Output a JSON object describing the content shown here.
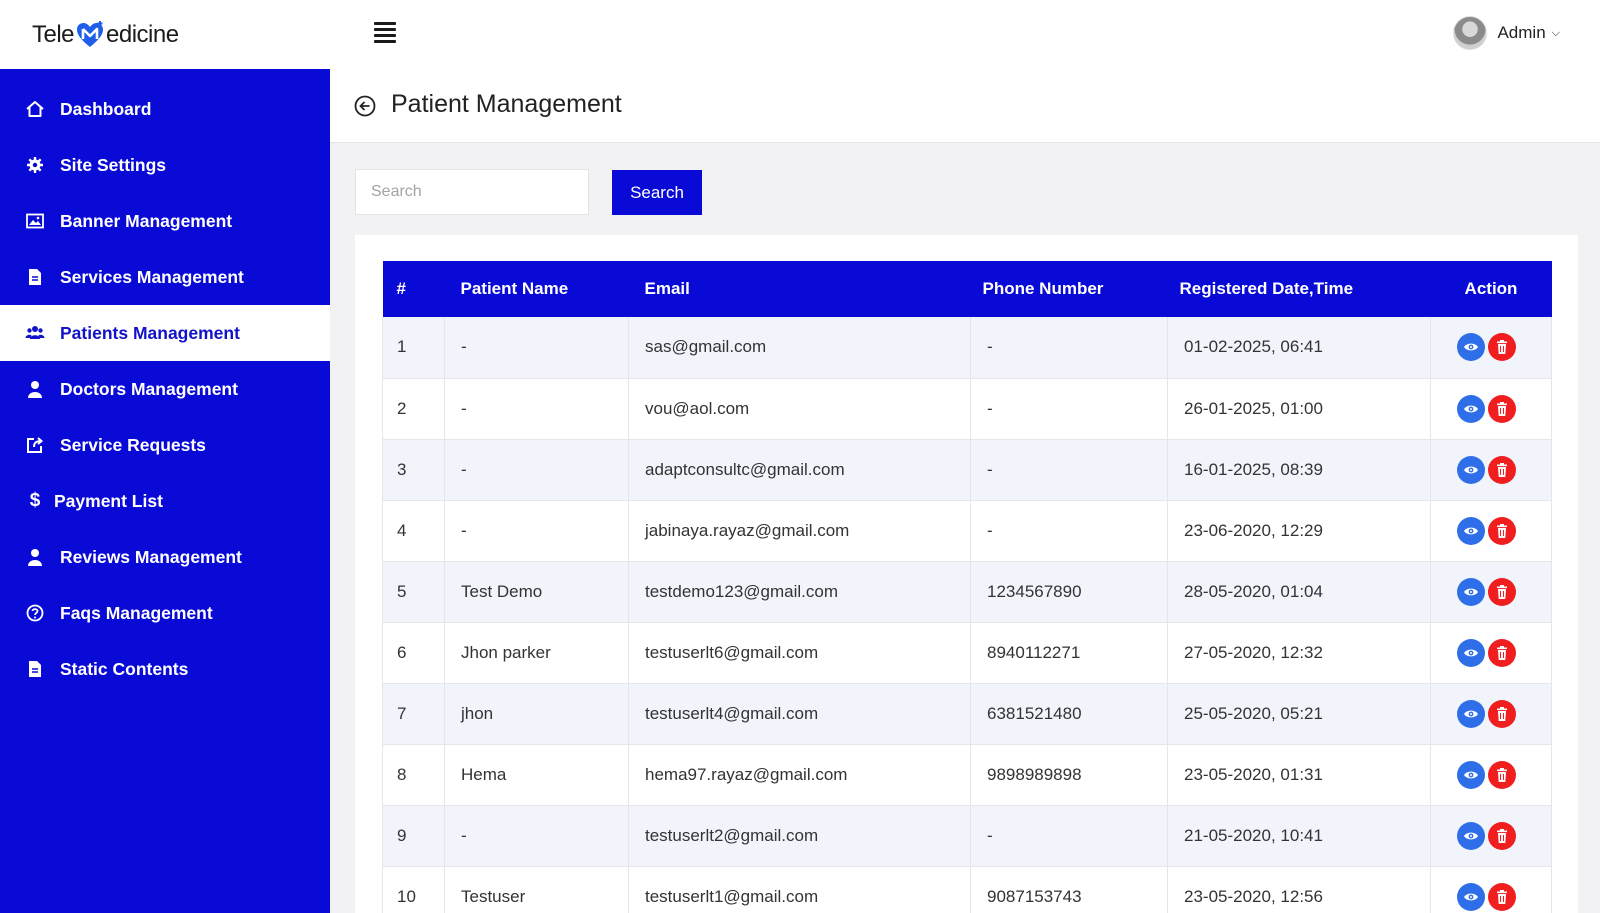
{
  "header": {
    "logo_left": "Tele",
    "logo_right": "edicine",
    "admin_name": "Admin"
  },
  "sidebar": {
    "items": [
      {
        "label": "Dashboard",
        "icon": "home-icon"
      },
      {
        "label": "Site Settings",
        "icon": "gear-icon"
      },
      {
        "label": "Banner Management",
        "icon": "image-icon"
      },
      {
        "label": "Services Management",
        "icon": "file-icon"
      },
      {
        "label": "Patients Management",
        "icon": "users-icon",
        "active": true
      },
      {
        "label": "Doctors Management",
        "icon": "user-icon"
      },
      {
        "label": "Service Requests",
        "icon": "share-icon"
      },
      {
        "label": "Payment List",
        "icon": "dollar-icon"
      },
      {
        "label": "Reviews Management",
        "icon": "user-icon"
      },
      {
        "label": "Faqs Management",
        "icon": "question-icon"
      },
      {
        "label": "Static Contents",
        "icon": "file-icon"
      }
    ]
  },
  "page": {
    "title": "Patient Management"
  },
  "search": {
    "placeholder": "Search",
    "button_label": "Search"
  },
  "table": {
    "columns": [
      "#",
      "Patient Name",
      "Email",
      "Phone Number",
      "Registered Date,Time",
      "Action"
    ],
    "rows": [
      {
        "num": "1",
        "name": "-",
        "email": "sas@gmail.com",
        "phone": "-",
        "date": "01-02-2025, 06:41"
      },
      {
        "num": "2",
        "name": "-",
        "email": "vou@aol.com",
        "phone": "-",
        "date": "26-01-2025, 01:00"
      },
      {
        "num": "3",
        "name": "-",
        "email": "adaptconsultc@gmail.com",
        "phone": "-",
        "date": "16-01-2025, 08:39"
      },
      {
        "num": "4",
        "name": "-",
        "email": "jabinaya.rayaz@gmail.com",
        "phone": "-",
        "date": "23-06-2020, 12:29"
      },
      {
        "num": "5",
        "name": "Test Demo",
        "email": "testdemo123@gmail.com",
        "phone": "1234567890",
        "date": "28-05-2020, 01:04"
      },
      {
        "num": "6",
        "name": "Jhon parker",
        "email": "testuserlt6@gmail.com",
        "phone": "8940112271",
        "date": "27-05-2020, 12:32"
      },
      {
        "num": "7",
        "name": "jhon",
        "email": "testuserlt4@gmail.com",
        "phone": "6381521480",
        "date": "25-05-2020, 05:21"
      },
      {
        "num": "8",
        "name": "Hema",
        "email": "hema97.rayaz@gmail.com",
        "phone": "9898989898",
        "date": "23-05-2020, 01:31"
      },
      {
        "num": "9",
        "name": "-",
        "email": "testuserlt2@gmail.com",
        "phone": "-",
        "date": "21-05-2020, 10:41"
      },
      {
        "num": "10",
        "name": "Testuser",
        "email": "testuserlt1@gmail.com",
        "phone": "9087153743",
        "date": "23-05-2020, 12:56"
      }
    ]
  },
  "colors": {
    "primary": "#0a0ad6",
    "view_button": "#2e6fe9",
    "delete_button": "#f01e1e"
  }
}
